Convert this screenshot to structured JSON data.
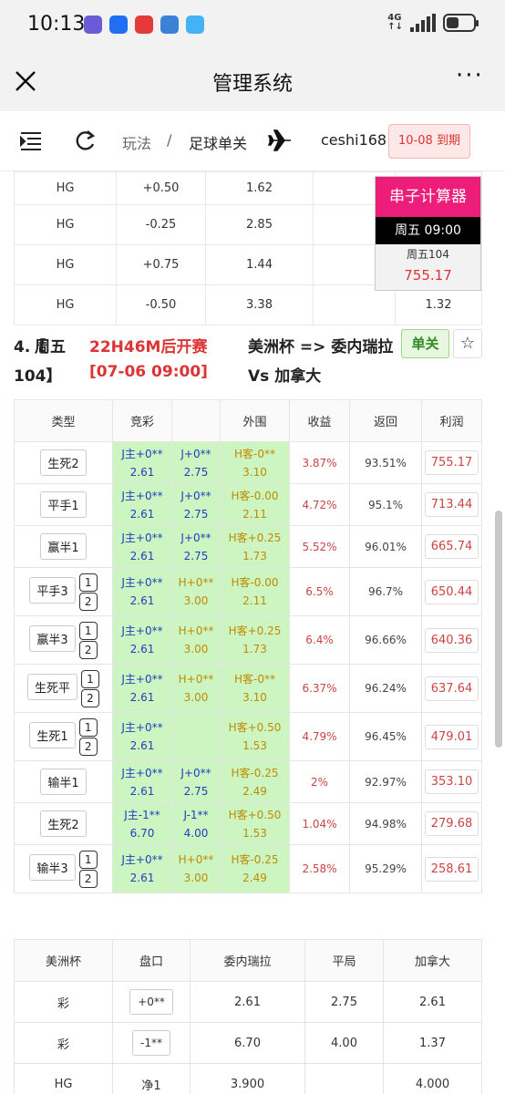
{
  "status_bar": {
    "time": "10:13",
    "network": "4G",
    "apps": [
      {
        "icon": "app-icon-1",
        "color": "#6b5cd6"
      },
      {
        "icon": "app-icon-2",
        "color": "#1f6ff2"
      },
      {
        "icon": "app-icon-3",
        "color": "#e63939"
      },
      {
        "icon": "app-icon-4",
        "color": "#3b82d6"
      },
      {
        "icon": "app-icon-5",
        "color": "#42b4f5"
      }
    ],
    "battery_level": 0.45
  },
  "titlebar": {
    "title": "管理系统"
  },
  "nav": {
    "crumb1": "玩法",
    "separator": "/",
    "crumb2": "足球单关",
    "user": "ceshi168",
    "expiry": "10-08 到期"
  },
  "top_table": {
    "rows": [
      {
        "type": "HG",
        "handicap": "+0.50",
        "odds": "1.62",
        "extra": ""
      },
      {
        "type": "HG",
        "handicap": "-0.25",
        "odds": "2.85",
        "extra": ""
      },
      {
        "type": "HG",
        "handicap": "+0.75",
        "odds": "1.44",
        "extra": ""
      },
      {
        "type": "HG",
        "handicap": "-0.50",
        "odds": "3.38",
        "extra": "1.32"
      }
    ]
  },
  "calculator": {
    "title": "串子计算器",
    "time": "周五 09:00",
    "match": "周五104",
    "value": "755.17"
  },
  "match": {
    "num": "4.【",
    "day": "周五",
    "countdown": "22H46M后开赛",
    "code": "104】",
    "kickoff": "[07-06 09:00]",
    "teams_line1": "美洲杯 => 委内瑞拉",
    "teams_line2": "Vs 加拿大",
    "badge": "单关",
    "star": "☆"
  },
  "main_table": {
    "headers": [
      "类型",
      "竞彩",
      "",
      "外围",
      "收益",
      "返回",
      "利润"
    ],
    "rows": [
      {
        "type": "生死2",
        "steps": false,
        "j1": "J主+0**",
        "j1o": "2.61",
        "j2": "J+0**",
        "j2o": "2.75",
        "j2c": "blue",
        "w": "H客-0**",
        "wo": "3.10",
        "yield": "3.87%",
        "ret": "93.51%",
        "profit": "755.17"
      },
      {
        "type": "平手1",
        "steps": false,
        "j1": "J主+0**",
        "j1o": "2.61",
        "j2": "J+0**",
        "j2o": "2.75",
        "j2c": "blue",
        "w": "H客-0.00",
        "wo": "2.11",
        "yield": "4.72%",
        "ret": "95.1%",
        "profit": "713.44"
      },
      {
        "type": "赢半1",
        "steps": false,
        "j1": "J主+0**",
        "j1o": "2.61",
        "j2": "J+0**",
        "j2o": "2.75",
        "j2c": "blue",
        "w": "H客+0.25",
        "wo": "1.73",
        "yield": "5.52%",
        "ret": "96.01%",
        "profit": "665.74"
      },
      {
        "type": "平手3",
        "steps": true,
        "j1": "J主+0**",
        "j1o": "2.61",
        "j2": "H+0**",
        "j2o": "3.00",
        "j2c": "gold",
        "w": "H客-0.00",
        "wo": "2.11",
        "yield": "6.5%",
        "ret": "96.7%",
        "profit": "650.44"
      },
      {
        "type": "赢半3",
        "steps": true,
        "j1": "J主+0**",
        "j1o": "2.61",
        "j2": "H+0**",
        "j2o": "3.00",
        "j2c": "gold",
        "w": "H客+0.25",
        "wo": "1.73",
        "yield": "6.4%",
        "ret": "96.66%",
        "profit": "640.36"
      },
      {
        "type": "生死平",
        "steps": true,
        "j1": "J主+0**",
        "j1o": "2.61",
        "j2": "H+0**",
        "j2o": "3.00",
        "j2c": "gold",
        "w": "H客-0**",
        "wo": "3.10",
        "yield": "6.37%",
        "ret": "96.24%",
        "profit": "637.64"
      },
      {
        "type": "生死1",
        "steps": true,
        "j1": "J主+0**",
        "j1o": "2.61",
        "j2": "",
        "j2o": "",
        "j2c": "blue",
        "w": "H客+0.50",
        "wo": "1.53",
        "yield": "4.79%",
        "ret": "96.45%",
        "profit": "479.01"
      },
      {
        "type": "输半1",
        "steps": false,
        "j1": "J主+0**",
        "j1o": "2.61",
        "j2": "J+0**",
        "j2o": "2.75",
        "j2c": "blue",
        "w": "H客-0.25",
        "wo": "2.49",
        "yield": "2%",
        "ret": "92.97%",
        "profit": "353.10"
      },
      {
        "type": "生死2",
        "steps": false,
        "j1": "J主-1**",
        "j1o": "6.70",
        "j2": "J-1**",
        "j2o": "4.00",
        "j2c": "blue",
        "w": "H客+0.50",
        "wo": "1.53",
        "yield": "1.04%",
        "ret": "94.98%",
        "profit": "279.68"
      },
      {
        "type": "输半3",
        "steps": true,
        "j1": "J主+0**",
        "j1o": "2.61",
        "j2": "H+0**",
        "j2o": "3.00",
        "j2c": "gold",
        "w": "H客-0.25",
        "wo": "2.49",
        "yield": "2.58%",
        "ret": "95.29%",
        "profit": "258.61"
      }
    ],
    "step_labels": [
      "1",
      "2"
    ]
  },
  "bottom_table": {
    "headers": [
      "美洲杯",
      "盘口",
      "委内瑞拉",
      "平局",
      "加拿大"
    ],
    "rows": [
      {
        "c0": "彩",
        "pk": "+0**",
        "home": "2.61",
        "draw": "2.75",
        "away": "2.61",
        "pk_btn": true
      },
      {
        "c0": "彩",
        "pk": "-1**",
        "home": "6.70",
        "draw": "4.00",
        "away": "1.37",
        "pk_btn": true
      },
      {
        "c0": "HG",
        "pk": "净1",
        "home": "3.900",
        "draw": "",
        "away": "4.000",
        "pk_btn": false
      }
    ]
  }
}
